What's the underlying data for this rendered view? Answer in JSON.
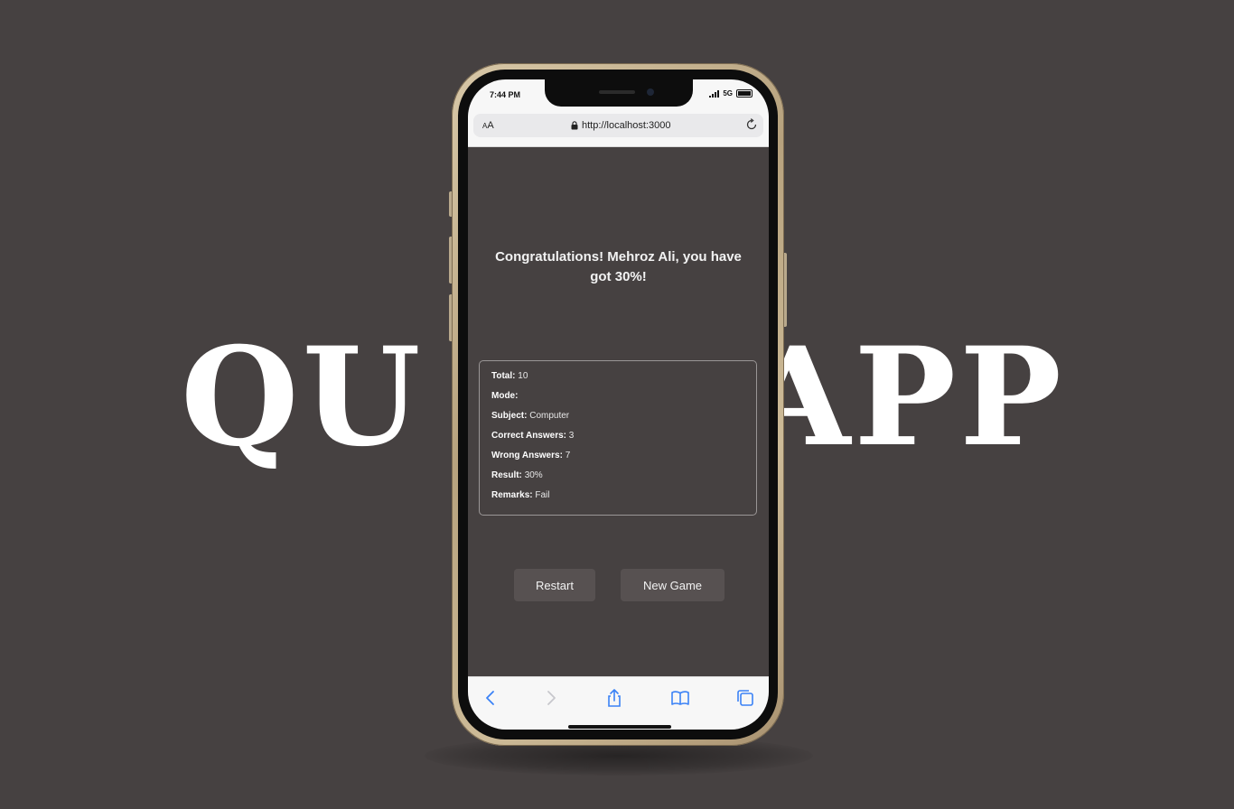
{
  "background": {
    "title_left": "QU",
    "title_right": "APP",
    "color": "#464141"
  },
  "status_bar": {
    "time": "7:44 PM",
    "network": "5G",
    "icons": [
      "signal-icon",
      "battery-icon"
    ]
  },
  "browser": {
    "text_size_label_small": "A",
    "text_size_label": "A",
    "url": "http://localhost:3000",
    "icons": [
      "lock-icon",
      "reload-icon"
    ],
    "toolbar_icons": [
      "back-icon",
      "forward-icon",
      "share-icon",
      "bookmarks-icon",
      "tabs-icon"
    ],
    "accent": "#3b82f6"
  },
  "result": {
    "headline": "Congratulations! Mehroz Ali, you have got 30%!",
    "stats": {
      "total_label": "Total:",
      "total_value": "10",
      "mode_label": "Mode:",
      "mode_value": "",
      "subject_label": "Subject:",
      "subject_value": "Computer",
      "correct_label": "Correct Answers:",
      "correct_value": "3",
      "wrong_label": "Wrong Answers:",
      "wrong_value": "7",
      "result_label": "Result:",
      "result_value": "30%",
      "remarks_label": "Remarks:",
      "remarks_value": "Fail"
    }
  },
  "actions": {
    "restart_label": "Restart",
    "new_game_label": "New Game"
  }
}
